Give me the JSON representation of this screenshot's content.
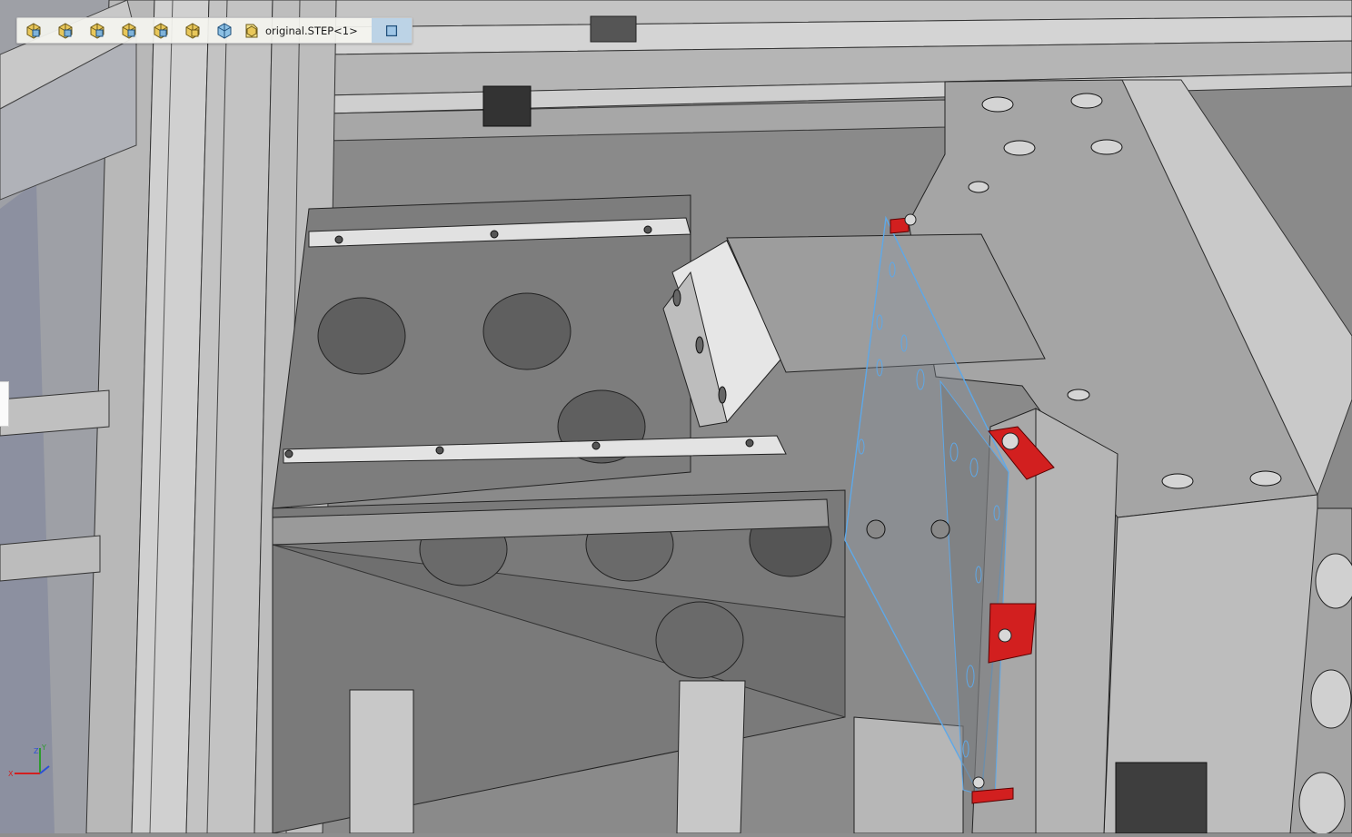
{
  "breadcrumb": {
    "items": [
      {
        "name": "assembly-1-icon"
      },
      {
        "name": "assembly-2-icon"
      },
      {
        "name": "assembly-3-icon"
      },
      {
        "name": "assembly-4-icon"
      },
      {
        "name": "assembly-5-icon"
      },
      {
        "name": "assembly-6-icon"
      },
      {
        "name": "part-icon"
      }
    ],
    "document_label": "original.STEP<1>",
    "document_icon": "assembly-folder-icon",
    "end_icon": "plane-icon"
  },
  "triad": {
    "x_label": "X",
    "y_label": "Y",
    "z_label": "Z"
  },
  "colors": {
    "viewport_bg": "#8e8e8e",
    "highlight_red": "#d21f1f",
    "selection_blue": "#5ea8e8",
    "breadcrumb_accent": "#bcd3e6"
  }
}
